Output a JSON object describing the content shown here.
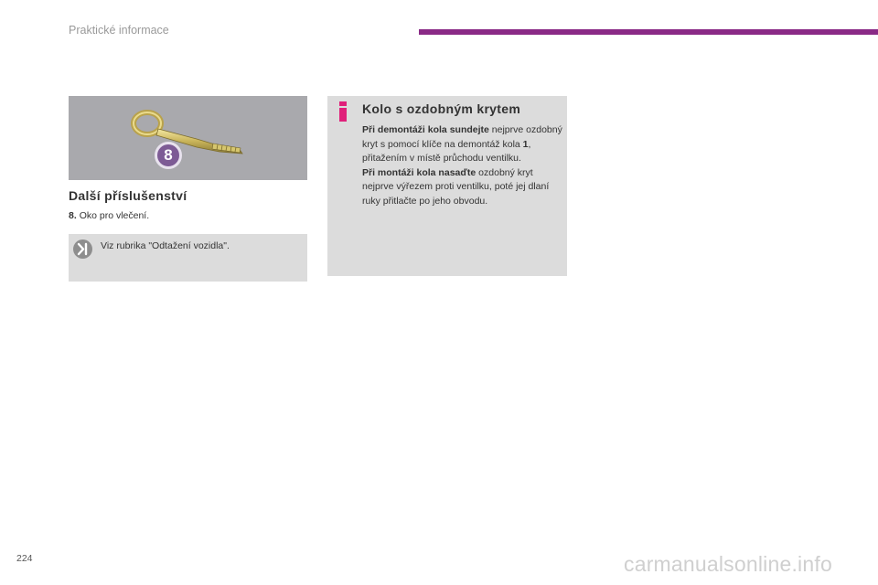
{
  "header": {
    "section_title": "Praktické informace",
    "accent_color": "#8a2a86"
  },
  "figure": {
    "subject": "towing-eye",
    "badge": "8"
  },
  "accessories": {
    "heading": "Další příslušenství",
    "item_number": "8.",
    "item_text": "Oko pro vlečení."
  },
  "reference": {
    "icon": "arrow-reference-icon",
    "text": "Viz rubrika \"Odtažení vozidla\"."
  },
  "info": {
    "icon": "info-icon",
    "title": "Kolo s ozdobným krytem",
    "p1_bold": "Při demontáži kola sundejte",
    "p1_rest_a": " nejprve ozdobný kryt s pomocí klíče na demontáž kola ",
    "p1_num": "1",
    "p1_rest_b": ", přitažením v místě průchodu ventilku.",
    "p2_bold": "Při montáži kola nasaďte",
    "p2_rest": " ozdobný kryt nejprve výřezem proti ventilku, poté jej dlaní ruky přitlačte po jeho obvodu."
  },
  "footer": {
    "page_number": "224",
    "watermark": "carmanualsonline.info"
  }
}
